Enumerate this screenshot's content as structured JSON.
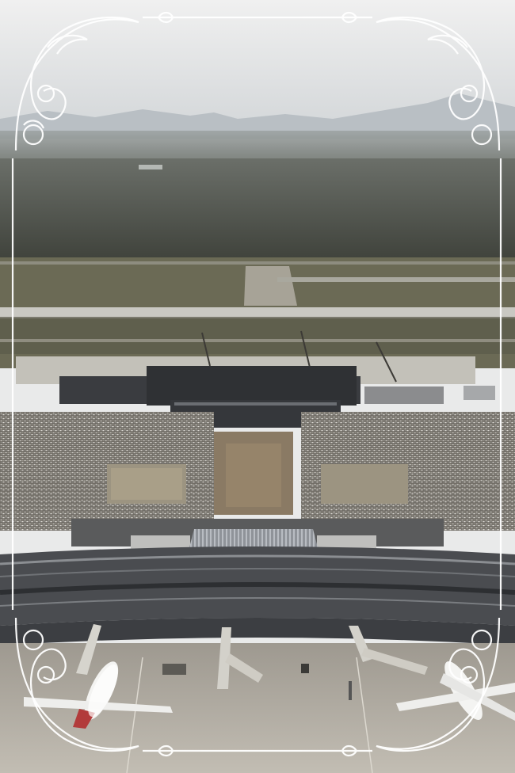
{
  "photo": {
    "subject": "aerial-airport-terminal",
    "frame": "ornate-white-scroll-border"
  },
  "colors": {
    "sky": "#e6e6e6",
    "mountain": "#b9bfc4",
    "forest": "#4c5049",
    "grass": "#6b6a55",
    "runway": "#c9c8c2",
    "apron": "#b0aaa0",
    "parking_lot": "#6e6a63",
    "terminal_roof": "#54565a",
    "frame_ornament": "#ffffff"
  }
}
